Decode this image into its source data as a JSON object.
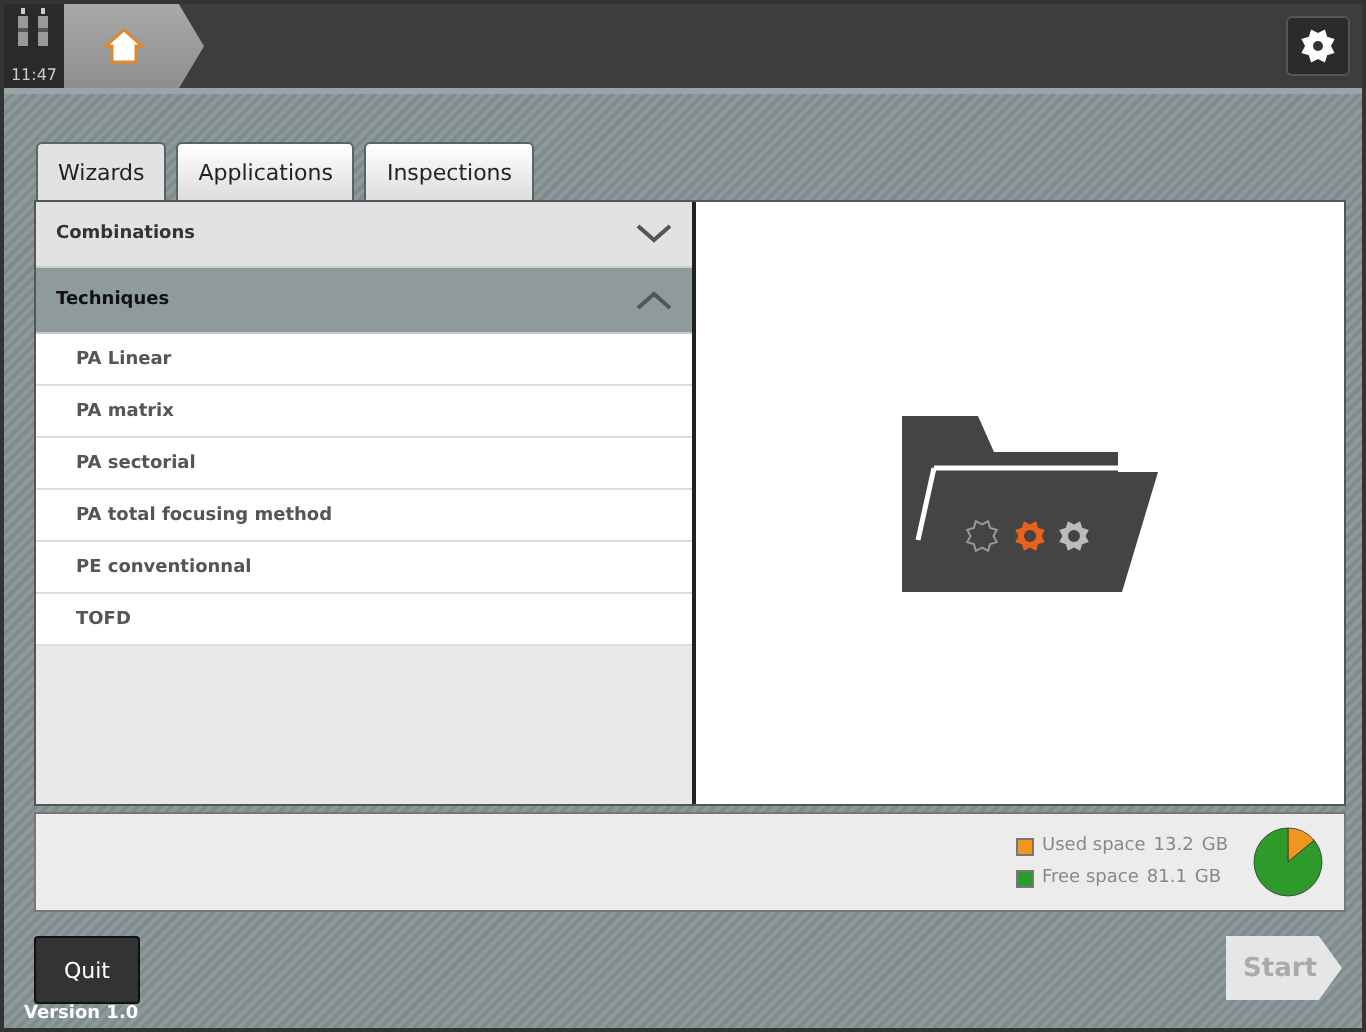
{
  "status": {
    "time": "11:47"
  },
  "tabs": [
    {
      "label": "Wizards",
      "selected": true
    },
    {
      "label": "Applications",
      "selected": false
    },
    {
      "label": "Inspections",
      "selected": false
    }
  ],
  "sections": [
    {
      "title": "Combinations",
      "expanded": false
    },
    {
      "title": "Techniques",
      "expanded": true,
      "children": [
        {
          "label": "PA Linear"
        },
        {
          "label": "PA matrix"
        },
        {
          "label": "PA sectorial"
        },
        {
          "label": "PA total focusing method"
        },
        {
          "label": "PE conventionnal"
        },
        {
          "label": "TOFD"
        }
      ]
    }
  ],
  "storage": {
    "items": [
      {
        "value": "13.2",
        "unit": "GB",
        "color": "#f0961e"
      },
      {
        "value": "81.1",
        "unit": "GB",
        "color": "#2e9a2a"
      }
    ],
    "chart_data": {
      "type": "pie",
      "categories": [
        "Used space",
        "Free space"
      ],
      "values": [
        14,
        86
      ]
    }
  },
  "footer": {
    "quit": "Quit",
    "start": "Start",
    "start_disabled": true,
    "version": "Version 1.0"
  }
}
